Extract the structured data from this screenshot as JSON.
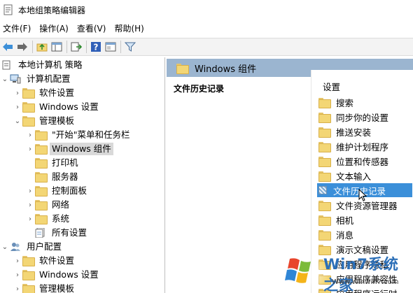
{
  "window": {
    "title": "本地组策略编辑器"
  },
  "menu": [
    "文件(F)",
    "操作(A)",
    "查看(V)",
    "帮助(H)"
  ],
  "toolbar": {
    "icons": [
      "back-arrow-icon",
      "forward-arrow-icon",
      "up-folder-icon",
      "show-tree-icon",
      "export-list-icon",
      "help-icon",
      "properties-icon",
      "filter-icon"
    ]
  },
  "tree": {
    "root": "本地计算机 策略",
    "computer_config": "计算机配置",
    "software_settings": "软件设置",
    "windows_settings": "Windows 设置",
    "admin_templates": "管理模板",
    "start_menu": "\"开始\"菜单和任务栏",
    "windows_components": "Windows 组件",
    "printers": "打印机",
    "server": "服务器",
    "control_panel": "控制面板",
    "network": "网络",
    "system": "系统",
    "all_settings": "所有设置",
    "user_config": "用户配置",
    "user_software_settings": "软件设置",
    "user_windows_settings": "Windows 设置",
    "user_admin_templates": "管理模板"
  },
  "right": {
    "header": "Windows 组件",
    "description_title": "文件历史记录",
    "list_header": "设置",
    "items": [
      "搜索",
      "同步你的设置",
      "推送安装",
      "维护计划程序",
      "位置和传感器",
      "文本输入",
      "文件历史记录",
      "文件资源管理器",
      "相机",
      "消息",
      "演示文稿设置",
      "应用程序隐私",
      "应用程序兼容性",
      "应用程序运行时"
    ]
  },
  "watermark": {
    "brand": "Win7系统之家",
    "url": "Www.Winwin7.com"
  }
}
